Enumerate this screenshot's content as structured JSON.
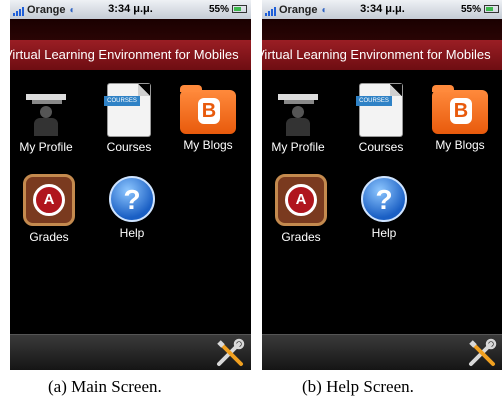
{
  "screens": [
    {
      "status": {
        "carrier": "Orange",
        "time": "3:34 μ.μ.",
        "battery": "55%"
      },
      "title": "Virtual Learning Environment for Mobiles",
      "items": [
        {
          "label": "My Profile",
          "icon": "profile-icon"
        },
        {
          "label": "Courses",
          "icon": "courses-icon"
        },
        {
          "label": "My Blogs",
          "icon": "blogger-icon"
        },
        {
          "label": "Grades",
          "icon": "grades-icon"
        },
        {
          "label": "Help",
          "icon": "help-icon"
        }
      ],
      "icon_texts": {
        "courses_tag": "COURSES",
        "grades_letter": "A",
        "help_mark": "?",
        "blog_letter": "B"
      },
      "caption": "(a) Main Screen."
    },
    {
      "status": {
        "carrier": "Orange",
        "time": "3:34 μ.μ.",
        "battery": "55%"
      },
      "title": "Virtual Learning Environment for Mobiles",
      "items": [
        {
          "label": "My Profile",
          "icon": "profile-icon"
        },
        {
          "label": "Courses",
          "icon": "courses-icon"
        },
        {
          "label": "My Blogs",
          "icon": "blogger-icon"
        },
        {
          "label": "Grades",
          "icon": "grades-icon"
        },
        {
          "label": "Help",
          "icon": "help-icon"
        }
      ],
      "icon_texts": {
        "courses_tag": "COURSES",
        "grades_letter": "A",
        "help_mark": "?",
        "blog_letter": "B"
      },
      "caption": "(b) Help Screen."
    }
  ],
  "colors": {
    "title_band": "#8b1a1f",
    "background": "#000000",
    "blog_orange": "#f26e1f",
    "help_blue": "#1a5fc4"
  }
}
